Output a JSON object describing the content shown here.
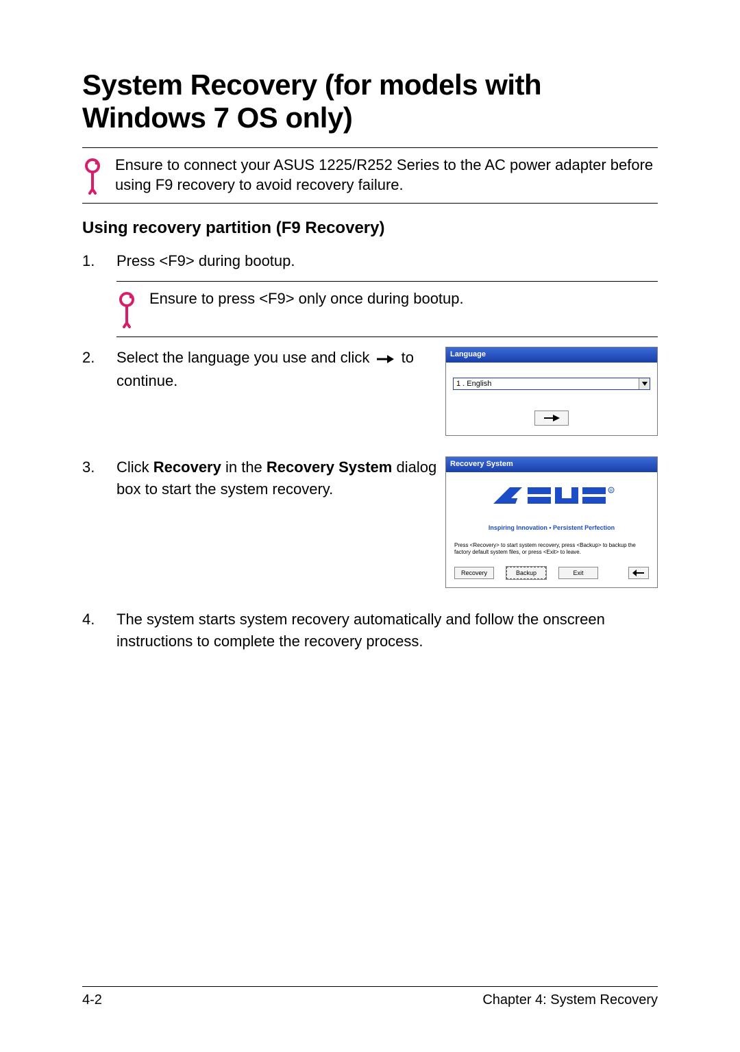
{
  "title": "System Recovery (for models with Windows 7 OS only)",
  "note1": "Ensure to connect your ASUS 1225/R252 Series to the AC power adapter before using F9 recovery to avoid recovery failure.",
  "subhead": "Using recovery partition (F9 Recovery)",
  "steps": {
    "s1": "Press <F9> during bootup.",
    "note2": "Ensure to press <F9> only once during bootup.",
    "s2a": "Select the language you use and click ",
    "s2b": " to continue.",
    "s3a": "Click ",
    "s3b": "Recovery",
    "s3c": " in the ",
    "s3d": "Recovery System",
    "s3e": " dialog box to start the system recovery.",
    "s4": "The system starts system recovery automatically and follow the onscreen instructions to complete the recovery process."
  },
  "dlg_lang": {
    "title": "Language",
    "value": "1 . English"
  },
  "dlg_rec": {
    "title": "Recovery System",
    "tagline": "Inspiring Innovation • Persistent Perfection",
    "instr": "Press <Recovery> to start system recovery, press <Backup> to backup the factory default system files, or press <Exit> to leave.",
    "btn_recovery": "Recovery",
    "btn_backup": "Backup",
    "btn_exit": "Exit"
  },
  "footer": {
    "left": "4-2",
    "right": "Chapter 4: System Recovery"
  }
}
